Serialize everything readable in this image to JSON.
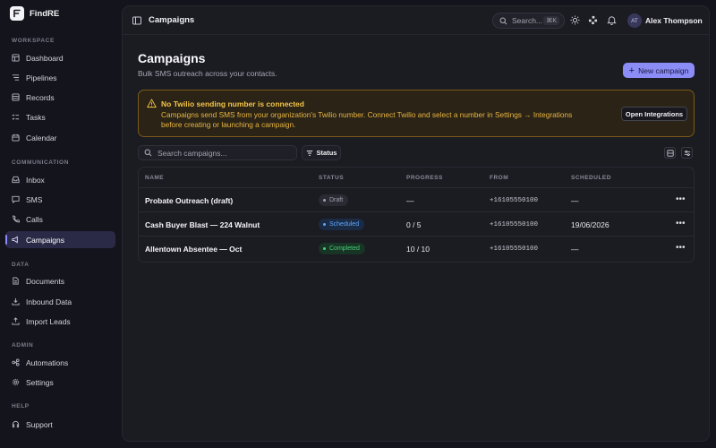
{
  "app": {
    "name": "FindRE"
  },
  "sidebar": {
    "sections": [
      {
        "label": "WORKSPACE"
      },
      {
        "label": "COMMUNICATION"
      },
      {
        "label": "DATA"
      },
      {
        "label": "ADMIN"
      },
      {
        "label": "HELP"
      }
    ],
    "items": [
      {
        "label": "Dashboard",
        "icon": "dashboard-icon"
      },
      {
        "label": "Pipelines",
        "icon": "pipelines-icon"
      },
      {
        "label": "Records",
        "icon": "records-icon"
      },
      {
        "label": "Tasks",
        "icon": "tasks-icon"
      },
      {
        "label": "Calendar",
        "icon": "calendar-icon"
      },
      {
        "label": "Inbox",
        "icon": "inbox-icon"
      },
      {
        "label": "SMS",
        "icon": "sms-icon"
      },
      {
        "label": "Calls",
        "icon": "phone-icon"
      },
      {
        "label": "Campaigns",
        "icon": "campaigns-icon",
        "active": true
      },
      {
        "label": "Documents",
        "icon": "documents-icon"
      },
      {
        "label": "Inbound Data",
        "icon": "download-icon"
      },
      {
        "label": "Import Leads",
        "icon": "upload-icon"
      },
      {
        "label": "Automations",
        "icon": "automations-icon"
      },
      {
        "label": "Settings",
        "icon": "gear-icon"
      },
      {
        "label": "Support",
        "icon": "support-icon"
      }
    ]
  },
  "topbar": {
    "title": "Campaigns",
    "search_label": "Search...",
    "search_shortcut": "⌘K",
    "user": {
      "initials": "AT",
      "name": "Alex Thompson"
    }
  },
  "page": {
    "title": "Campaigns",
    "subtitle": "Bulk SMS outreach across your contacts.",
    "new_button": "New campaign"
  },
  "alert": {
    "title": "No Twilio sending number is connected",
    "body": "Campaigns send SMS from your organization's Twilio number. Connect Twilio and select a number in Settings → Integrations before creating or launching a campaign.",
    "button": "Open Integrations"
  },
  "filters": {
    "search_placeholder": "Search campaigns...",
    "status_label": "Status"
  },
  "table": {
    "columns": [
      "NAME",
      "STATUS",
      "PROGRESS",
      "FROM",
      "SCHEDULED"
    ],
    "rows": [
      {
        "name": "Probate Outreach (draft)",
        "status": "Draft",
        "progress": "—",
        "from": "+16105550100",
        "scheduled": "—"
      },
      {
        "name": "Cash Buyer Blast — 224 Walnut",
        "status": "Scheduled",
        "progress": "0 / 5",
        "from": "+16105550100",
        "scheduled": "19/06/2026"
      },
      {
        "name": "Allentown Absentee — Oct",
        "status": "Completed",
        "progress": "10 / 10",
        "from": "+16105550100",
        "scheduled": "—"
      }
    ]
  },
  "colors": {
    "accent": "#8b8cf6",
    "warning": "#f4c447",
    "draft": "#a0a0ae",
    "scheduled": "#5aa8ff",
    "completed": "#4ad07a"
  }
}
